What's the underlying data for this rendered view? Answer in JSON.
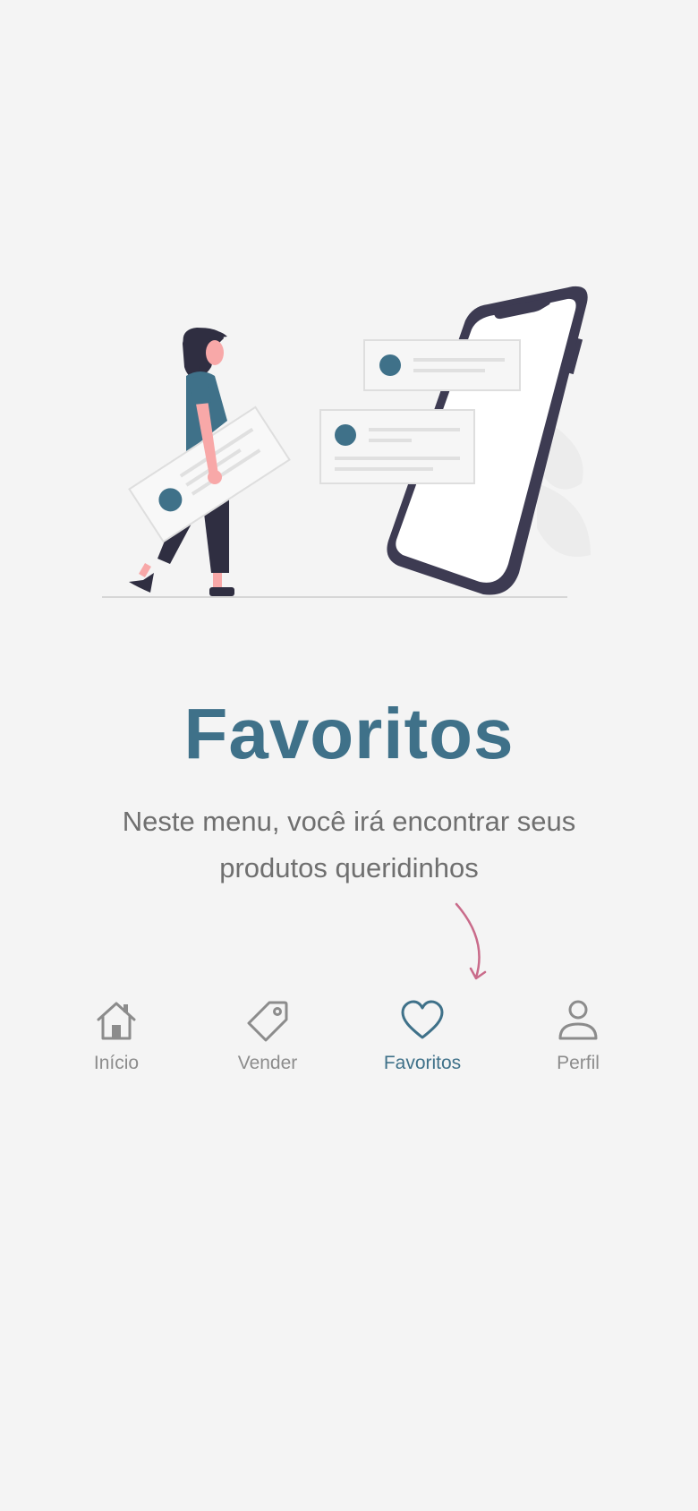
{
  "onboarding": {
    "title": "Favoritos",
    "description": "Neste menu, você irá encontrar seus produtos queridinhos"
  },
  "tabbar": {
    "active": "favoritos",
    "items": [
      {
        "id": "inicio",
        "label": "Início",
        "icon": "home-icon"
      },
      {
        "id": "vender",
        "label": "Vender",
        "icon": "tag-icon"
      },
      {
        "id": "favoritos",
        "label": "Favoritos",
        "icon": "heart-icon"
      },
      {
        "id": "perfil",
        "label": "Perfil",
        "icon": "user-icon"
      }
    ]
  },
  "colors": {
    "accent": "#3f7189",
    "inactive": "#8c8c8c",
    "arrow": "#c96b8a",
    "background": "#f4f4f4"
  }
}
